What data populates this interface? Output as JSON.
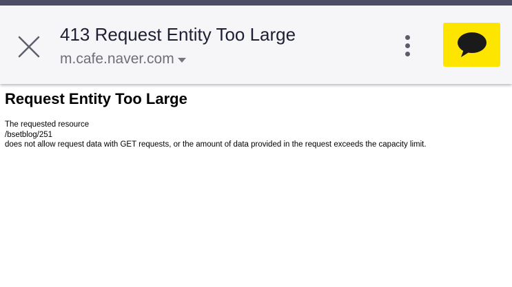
{
  "status_bar": {
    "color": "#4d4e63"
  },
  "toolbar": {
    "close_icon": "close-icon",
    "title": "413 Request Entity Too Large",
    "url": "m.cafe.naver.com",
    "url_dropdown_icon": "caret-down-icon",
    "menu_icon": "more-vertical-icon",
    "share_icon": "kakaotalk-speech-bubble-icon",
    "share_button_color": "#fee500"
  },
  "page": {
    "heading": "Request Entity Too Large",
    "lines": [
      "The requested resource",
      "/bsetblog/251",
      "does not allow request data with GET requests, or the amount of data provided in the request exceeds the capacity limit."
    ]
  }
}
